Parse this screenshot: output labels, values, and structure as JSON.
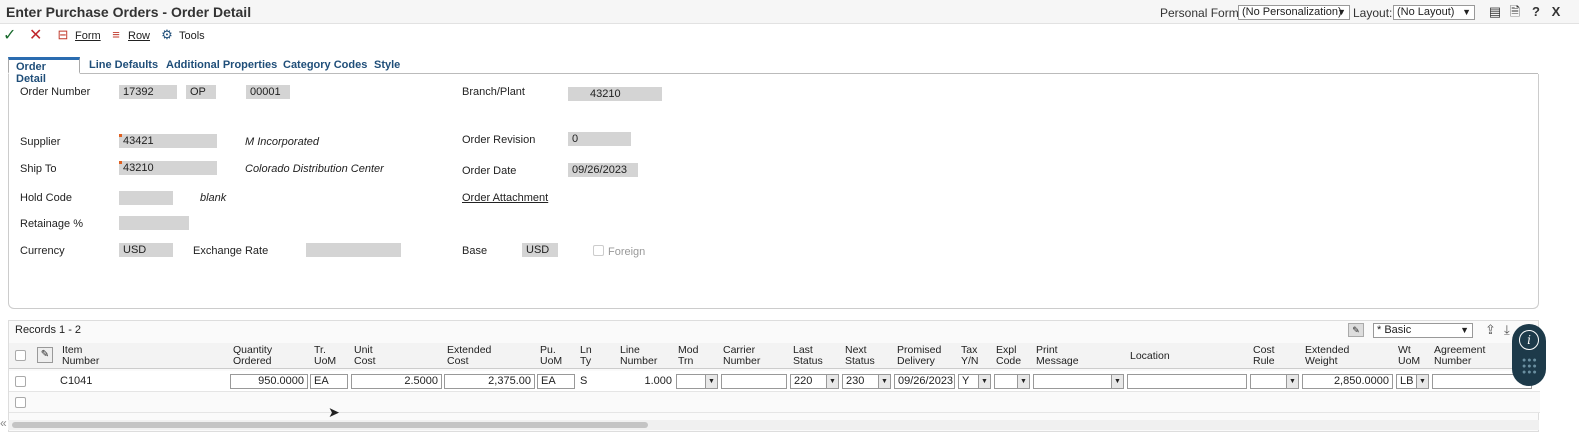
{
  "window": {
    "title": "Enter Purchase Orders - Order Detail",
    "personal_form_label": "Personal Form:",
    "personal_form_value": "(No Personalization)",
    "layout_label": "Layout:",
    "layout_value": "(No Layout)",
    "icons": [
      "notes-icon",
      "document-icon",
      "help-icon",
      "close-icon"
    ],
    "help_glyph": "?",
    "close_glyph": "X"
  },
  "toolbar": {
    "ok_icon": "checkmark-icon",
    "cancel_icon": "x-icon",
    "form_label": "Form",
    "row_label": "Row",
    "tools_label": "Tools"
  },
  "tabs": [
    {
      "label": "Order Detail",
      "active": true
    },
    {
      "label": "Line Defaults",
      "active": false
    },
    {
      "label": "Additional Properties",
      "active": false
    },
    {
      "label": "Category Codes",
      "active": false
    },
    {
      "label": "Style",
      "active": false
    }
  ],
  "header": {
    "order_number_label": "Order Number",
    "order_number": "17392",
    "order_type": "OP",
    "order_company": "00001",
    "branch_plant_label": "Branch/Plant",
    "branch_plant": "43210",
    "supplier_label": "Supplier",
    "supplier": "43421",
    "supplier_name": "M Incorporated",
    "order_revision_label": "Order Revision",
    "order_revision": "0",
    "ship_to_label": "Ship To",
    "ship_to": "43210",
    "ship_to_name": "Colorado Distribution Center",
    "order_date_label": "Order Date",
    "order_date": "09/26/2023",
    "hold_code_label": "Hold Code",
    "hold_code": "",
    "hold_code_desc": "blank",
    "order_attachment_label": "Order Attachment",
    "retainage_label": "Retainage %",
    "retainage": "",
    "currency_label": "Currency",
    "currency": "USD",
    "exchange_rate_label": "Exchange Rate",
    "exchange_rate": "",
    "base_label": "Base",
    "base": "USD",
    "foreign_label": "Foreign"
  },
  "grid": {
    "records": "Records 1 - 2",
    "view": "* Basic",
    "columns": [
      {
        "l1": "Item",
        "l2": "Number"
      },
      {
        "l1": "Quantity",
        "l2": "Ordered"
      },
      {
        "l1": "Tr.",
        "l2": "UoM"
      },
      {
        "l1": "Unit",
        "l2": "Cost"
      },
      {
        "l1": "Extended",
        "l2": "Cost"
      },
      {
        "l1": "Pu.",
        "l2": "UoM"
      },
      {
        "l1": "Ln",
        "l2": "Ty"
      },
      {
        "l1": "Line",
        "l2": "Number"
      },
      {
        "l1": "Mod",
        "l2": "Trn"
      },
      {
        "l1": "Carrier",
        "l2": "Number"
      },
      {
        "l1": "Last",
        "l2": "Status"
      },
      {
        "l1": "Next",
        "l2": "Status"
      },
      {
        "l1": "Promised",
        "l2": "Delivery"
      },
      {
        "l1": "Tax",
        "l2": "Y/N"
      },
      {
        "l1": "Expl",
        "l2": "Code"
      },
      {
        "l1": "Print",
        "l2": "Message"
      },
      {
        "l1": "Location",
        "l2": ""
      },
      {
        "l1": "Cost",
        "l2": "Rule"
      },
      {
        "l1": "Extended",
        "l2": "Weight"
      },
      {
        "l1": "Wt",
        "l2": "UoM"
      },
      {
        "l1": "Agreement",
        "l2": "Number"
      }
    ],
    "row1": {
      "item": "C1041",
      "qty": "950.0000",
      "tr_uom": "EA",
      "unit_cost": "2.5000",
      "ext_cost": "2,375.00",
      "pu_uom": "EA",
      "ln_ty": "S",
      "line_no": "1.000",
      "mod_trn": "",
      "carrier": "",
      "last_status": "220",
      "next_status": "230",
      "promised": "09/26/2023",
      "tax": "Y",
      "expl": "",
      "print_msg": "",
      "location": "",
      "cost_rule": "",
      "ext_weight": "2,850.0000",
      "wt_uom": "LB",
      "agreement": ""
    }
  }
}
